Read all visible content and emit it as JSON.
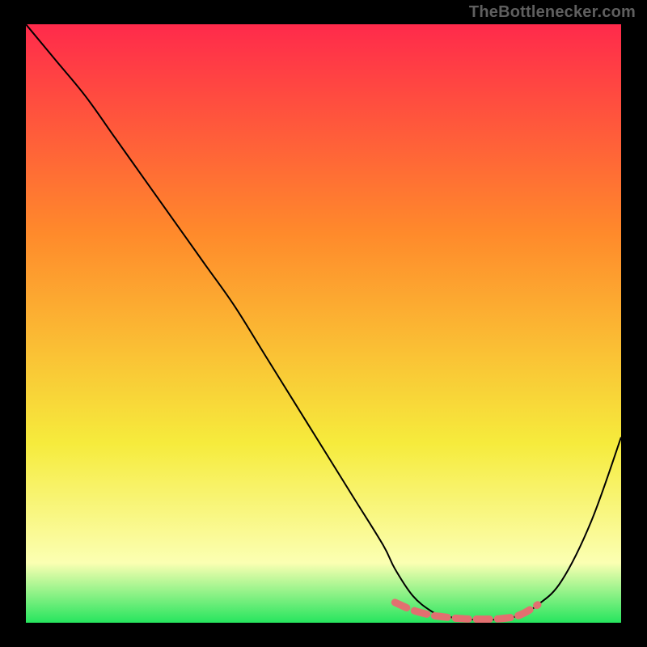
{
  "attribution": "TheBottlenecker.com",
  "chart_data": {
    "type": "line",
    "title": "",
    "xlabel": "",
    "ylabel": "",
    "xlim": [
      0,
      100
    ],
    "ylim": [
      0,
      100
    ],
    "grid": false,
    "series": [
      {
        "name": "bottleneck-curve",
        "color": "#000000",
        "x": [
          0,
          5,
          10,
          15,
          20,
          25,
          30,
          35,
          40,
          45,
          50,
          55,
          60,
          62,
          65,
          68,
          70,
          73,
          76,
          80,
          83,
          86,
          90,
          95,
          100
        ],
        "y": [
          100,
          94,
          88,
          81,
          74,
          67,
          60,
          53,
          45,
          37,
          29,
          21,
          13,
          9,
          4.5,
          2,
          1.2,
          0.7,
          0.5,
          0.6,
          1.3,
          3,
          7,
          17,
          31
        ]
      },
      {
        "name": "optimal-band",
        "color": "#E27070",
        "x": [
          62,
          65,
          68,
          70,
          73,
          76,
          80,
          83,
          86
        ],
        "y": [
          3.4,
          2.1,
          1.3,
          1.0,
          0.7,
          0.6,
          0.7,
          1.3,
          3.0
        ]
      }
    ],
    "background_gradient": {
      "top": "#FF2A4B",
      "mid1": "#FF8A2B",
      "mid2": "#F6EB3C",
      "mid3": "#FBFFB2",
      "bottom": "#26E55E"
    }
  }
}
